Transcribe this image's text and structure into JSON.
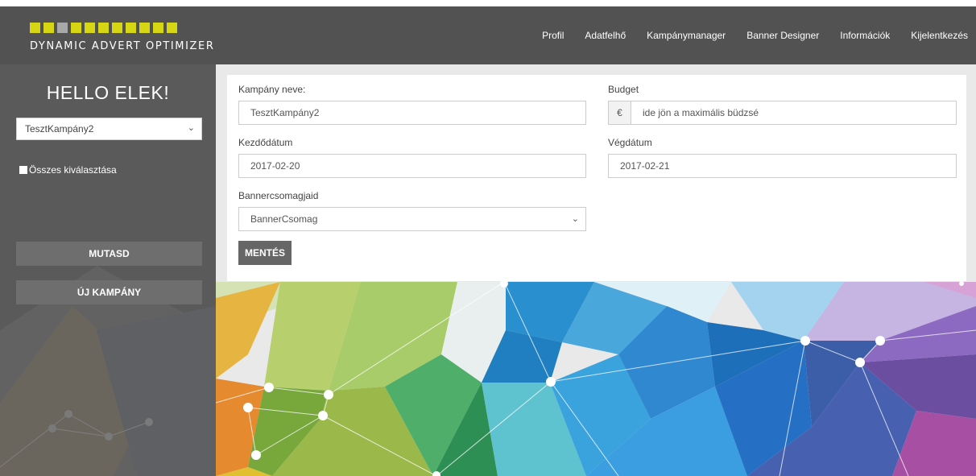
{
  "header": {
    "logo_text": "DYNAMIC ADVERT OPTIMIZER",
    "logo_squares": 11,
    "nav": [
      "Profil",
      "Adatfelhő",
      "Kampánymanager",
      "Banner Designer",
      "Információk",
      "Kijelentkezés"
    ]
  },
  "sidebar": {
    "greeting": "HELLO ELEK!",
    "campaign_select": "TesztKampány2",
    "select_all_label": "Összes kiválasztása",
    "show_button": "MUTASD",
    "new_campaign_button": "ÚJ KAMPÁNY"
  },
  "form": {
    "name_label": "Kampány neve:",
    "name_value": "TesztKampány2",
    "budget_label": "Budget",
    "currency_symbol": "€",
    "budget_placeholder": "ide jön a maximális büdzsé",
    "start_label": "Kezdődátum",
    "start_value": "2017-02-20",
    "end_label": "Végdátum",
    "end_value": "2017-02-21",
    "packages_label": "Bannercsomagjaid",
    "packages_value": "BannerCsomag",
    "save_button": "MENTÉS"
  },
  "colors": {
    "header_bg": "#525252",
    "sidebar_bg": "#5a5a5a",
    "logo_accent": "#d6d614",
    "button_bg": "#666666"
  },
  "icons": [
    "chevron-down-icon",
    "checkbox-icon"
  ]
}
